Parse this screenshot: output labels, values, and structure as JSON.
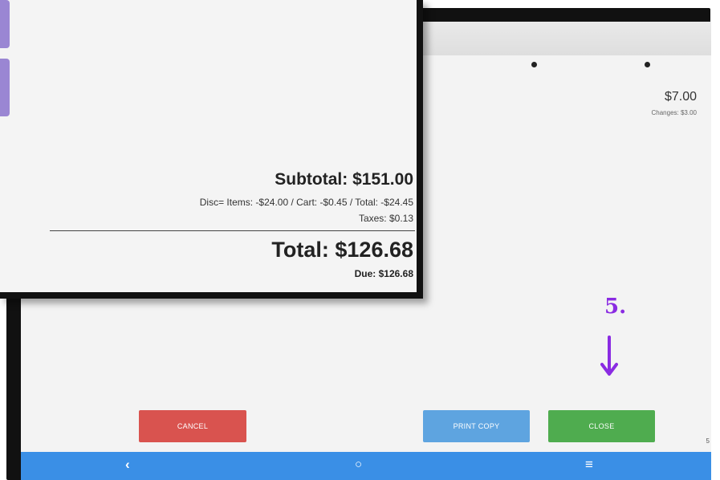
{
  "background_screen": {
    "price": "$7.00",
    "changes": "Changes: $3.00",
    "buttons": {
      "cancel": "CANCEL",
      "print_copy": "PRINT COPY",
      "close": "CLOSE"
    },
    "navbar": {
      "back": "‹",
      "home": "○",
      "menu": "≡"
    },
    "edge_text": "5"
  },
  "overlay": {
    "subtotal": "Subtotal: $151.00",
    "discount": "Disc= Items: -$24.00 / Cart: -$0.45 / Total: -$24.45",
    "taxes": "Taxes: $0.13",
    "total": "Total: $126.68",
    "due": "Due: $126.68"
  },
  "annotation": {
    "step": "5.",
    "color": "#8a2be2"
  },
  "colors": {
    "cancel": "#d9534f",
    "print": "#5ea4e0",
    "close": "#4fac4f",
    "navbar": "#3a8fe6",
    "side_buttons": "#9a86d3"
  }
}
